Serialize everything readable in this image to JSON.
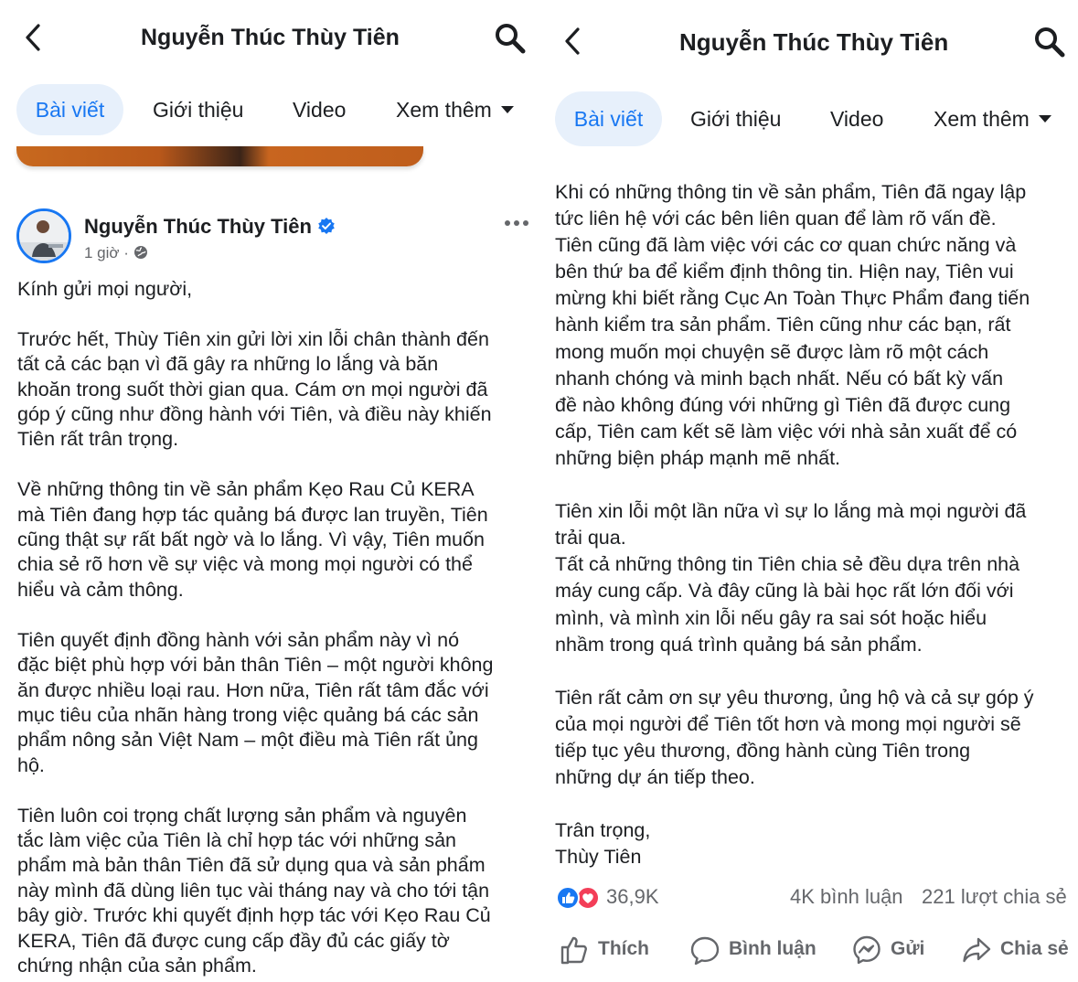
{
  "page_title": "Nguyễn Thúc Thùy Tiên",
  "tabs": [
    "Bài viết",
    "Giới thiệu",
    "Video",
    "Xem thêm"
  ],
  "post": {
    "author": "Nguyễn Thúc Thùy Tiên",
    "time": "1 giờ",
    "time_separator": "·",
    "left_text": "Kính gửi mọi người,\n\nTrước hết, Thùy Tiên xin gửi lời xin lỗi chân thành đến\ntất cả các bạn vì đã gây ra những lo lắng và băn\nkhoăn trong suốt thời gian qua. Cám ơn mọi người đã\ngóp ý cũng như đồng hành với Tiên, và điều này khiến\nTiên rất trân trọng.\n\nVề những thông tin về sản phẩm Kẹo Rau Củ KERA\nmà Tiên đang hợp tác quảng bá được lan truyền, Tiên\ncũng thật sự rất bất ngờ và lo lắng. Vì vậy, Tiên muốn\nchia sẻ rõ hơn về sự việc và mong mọi người có thể\nhiểu và cảm thông.\n\nTiên quyết định đồng hành với sản phẩm này vì nó\nđặc biệt phù hợp với bản thân Tiên – một người không\năn được nhiều loại rau. Hơn nữa, Tiên rất tâm đắc với\nmục tiêu của nhãn hàng trong việc quảng bá các sản\nphẩm nông sản Việt Nam – một điều mà Tiên rất ủng\nhộ.\n\nTiên luôn coi trọng chất lượng sản phẩm và nguyên\ntắc làm việc của Tiên là chỉ hợp tác với những sản\nphẩm mà bản thân Tiên đã sử dụng qua và sản phẩm\nnày mình đã dùng liên tục vài tháng nay và cho tới tận\nbây giờ. Trước khi quyết định hợp tác với Kẹo Rau Củ\nKERA, Tiên đã được cung cấp đầy đủ các giấy tờ\nchứng nhận của sản phẩm.",
    "right_text": "Khi có những thông tin về sản phẩm, Tiên đã ngay lập\ntức liên hệ với các bên liên quan để làm rõ vấn đề.\nTiên cũng đã làm việc với các cơ quan chức năng và\nbên thứ ba để kiểm định thông tin. Hiện nay, Tiên vui\nmừng khi biết rằng Cục An Toàn Thực Phẩm đang tiến\nhành kiểm tra sản phẩm. Tiên cũng như các bạn, rất\nmong muốn mọi chuyện sẽ được làm rõ một cách\nnhanh chóng và minh bạch nhất. Nếu có bất kỳ vấn\nđề nào không đúng với những gì Tiên đã được cung\ncấp, Tiên cam kết sẽ làm việc với nhà sản xuất để có\nnhững biện pháp mạnh mẽ nhất.\n\nTiên xin lỗi một lần nữa vì sự lo lắng mà mọi người đã\ntrải qua.\nTất cả những thông tin Tiên chia sẻ đều dựa trên nhà\nmáy cung cấp. Và đây cũng là bài học rất lớn đối với\nmình, và mình xin lỗi nếu gây ra sai sót hoặc hiểu\nnhầm trong quá trình quảng bá sản phẩm.\n\nTiên rất cảm ơn sự yêu thương, ủng hộ và cả sự góp ý\ncủa mọi người để Tiên tốt hơn và mong mọi người sẽ\ntiếp tục yêu thương, đồng hành cùng Tiên trong\nnhững dự án tiếp theo.\n\nTrân trọng,\nThùy Tiên"
  },
  "stats": {
    "reactions": "36,9K",
    "comments": "4K bình luận",
    "shares": "221 lượt chia sẻ"
  },
  "actions": {
    "like": "Thích",
    "comment": "Bình luận",
    "send": "Gửi",
    "share": "Chia sẻ"
  },
  "colors": {
    "accent": "#1877f2",
    "active_tab_bg": "#e7f0fb",
    "secondary_text": "#65676b",
    "love": "#f33e58"
  },
  "icons": [
    "back-icon",
    "search-icon",
    "verified-badge-icon",
    "globe-icon",
    "more-options-icon",
    "like-reaction-icon",
    "love-reaction-icon",
    "thumbs-up-icon",
    "comment-bubble-icon",
    "messenger-icon",
    "share-arrow-icon"
  ]
}
